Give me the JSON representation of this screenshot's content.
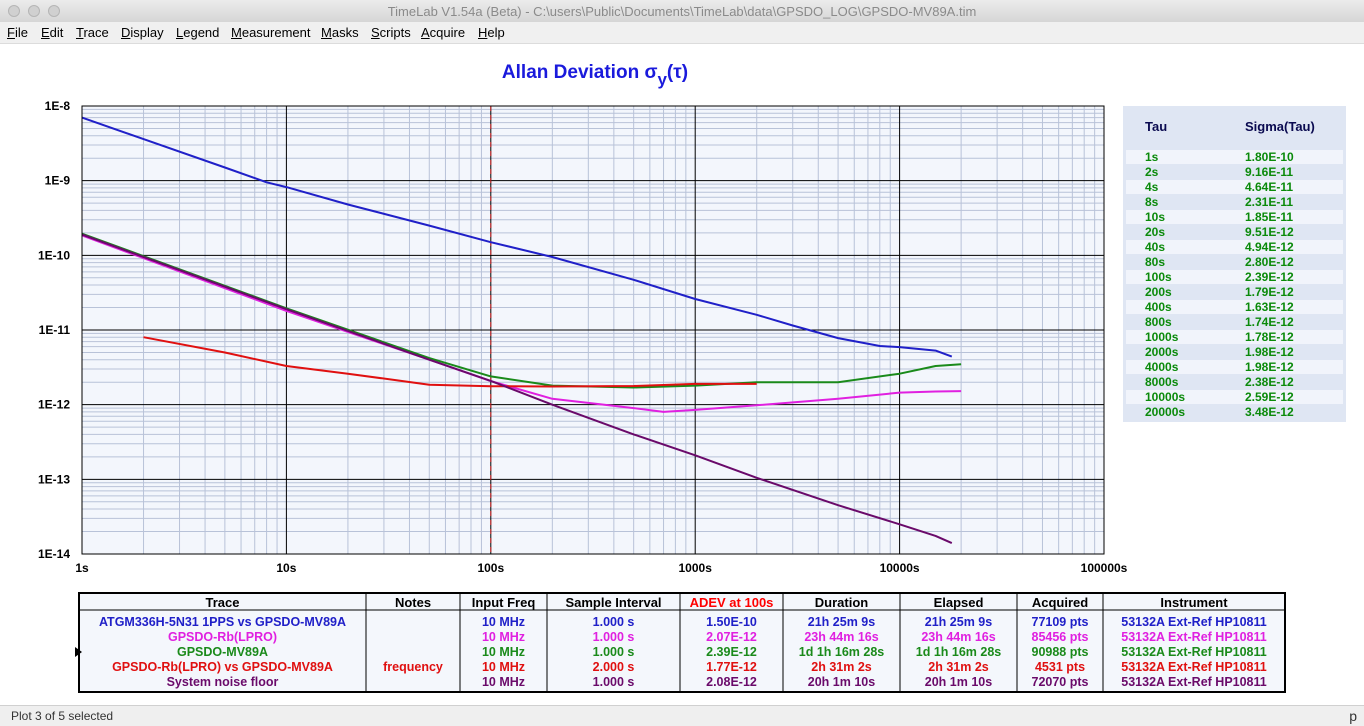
{
  "window": {
    "title": "TimeLab V1.54a (Beta) - C:\\users\\Public\\Documents\\TimeLab\\data\\GPSDO_LOG\\GPSDO-MV89A.tim"
  },
  "menu": [
    "File",
    "Edit",
    "Trace",
    "Display",
    "Legend",
    "Measurement",
    "Masks",
    "Scripts",
    "Acquire",
    "Help"
  ],
  "chart_data": {
    "type": "line",
    "title": "Allan Deviation σ",
    "title_sub": "y",
    "title_tail": "(τ)",
    "xscale": "log",
    "yscale": "log",
    "xlim": [
      1,
      100000
    ],
    "ylim": [
      1e-14,
      1e-08
    ],
    "grid": true,
    "reference_tau": 100,
    "x_ticks": [
      {
        "v": 1,
        "label": "1s"
      },
      {
        "v": 10,
        "label": "10s"
      },
      {
        "v": 100,
        "label": "100s"
      },
      {
        "v": 1000,
        "label": "1000s"
      },
      {
        "v": 10000,
        "label": "10000s"
      },
      {
        "v": 100000,
        "label": "100000s"
      }
    ],
    "y_ticks": [
      {
        "v": 1e-08,
        "label": "1E-8"
      },
      {
        "v": 1e-09,
        "label": "1E-9"
      },
      {
        "v": 1e-10,
        "label": "1E-10"
      },
      {
        "v": 1e-11,
        "label": "1E-11"
      },
      {
        "v": 1e-12,
        "label": "1E-12"
      },
      {
        "v": 1e-13,
        "label": "1E-13"
      },
      {
        "v": 1e-14,
        "label": "1E-14"
      }
    ],
    "series": [
      {
        "name": "ATGM336H-5N31 1PPS vs GPSDO-MV89A",
        "color": "#2020c8",
        "x": [
          1,
          2,
          5,
          8,
          10,
          20,
          50,
          100,
          200,
          500,
          1000,
          2000,
          3000,
          5000,
          8000,
          10000,
          15000,
          18000
        ],
        "y": [
          7e-09,
          3.6e-09,
          1.5e-09,
          9.5e-10,
          8.2e-10,
          4.8e-10,
          2.5e-10,
          1.5e-10,
          9.5e-11,
          4.7e-11,
          2.6e-11,
          1.6e-11,
          1.15e-11,
          7.8e-12,
          6.1e-12,
          5.9e-12,
          5.3e-12,
          4.4e-12
        ]
      },
      {
        "name": "GPSDO-Rb(LPRO)",
        "color": "#e020e0",
        "x": [
          1,
          10,
          50,
          100,
          200,
          500,
          700,
          1000,
          2000,
          5000,
          10000,
          15000,
          20000
        ],
        "y": [
          1.85e-10,
          1.8e-11,
          4e-12,
          2.07e-12,
          1.2e-12,
          9e-13,
          8e-13,
          8.5e-13,
          9.8e-13,
          1.2e-12,
          1.45e-12,
          1.5e-12,
          1.52e-12
        ]
      },
      {
        "name": "GPSDO-MV89A",
        "color": "#1a8a1a",
        "x": [
          1,
          10,
          50,
          100,
          200,
          500,
          1000,
          2000,
          5000,
          10000,
          15000,
          20000
        ],
        "y": [
          1.95e-10,
          1.95e-11,
          4.2e-12,
          2.39e-12,
          1.8e-12,
          1.7e-12,
          1.8e-12,
          2e-12,
          2e-12,
          2.6e-12,
          3.3e-12,
          3.48e-12
        ]
      },
      {
        "name": "GPSDO-Rb(LPRO) vs GPSDO-MV89A",
        "color": "#e01010",
        "x": [
          2,
          5,
          10,
          20,
          50,
          100,
          200,
          500,
          1000,
          2000
        ],
        "y": [
          8e-12,
          5e-12,
          3.3e-12,
          2.6e-12,
          1.85e-12,
          1.77e-12,
          1.75e-12,
          1.78e-12,
          1.9e-12,
          1.9e-12
        ]
      },
      {
        "name": "System noise floor",
        "color": "#6a0a6a",
        "x": [
          1,
          10,
          50,
          100,
          200,
          500,
          1000,
          2000,
          5000,
          10000,
          15000,
          18000
        ],
        "y": [
          1.9e-10,
          1.9e-11,
          4e-12,
          2.08e-12,
          1e-12,
          4e-13,
          2.1e-13,
          1.05e-13,
          4.5e-14,
          2.5e-14,
          1.75e-14,
          1.4e-14
        ]
      }
    ]
  },
  "sigma_table": {
    "headers": [
      "Tau",
      "Sigma(Tau)"
    ],
    "rows": [
      [
        "1s",
        "1.80E-10"
      ],
      [
        "2s",
        "9.16E-11"
      ],
      [
        "4s",
        "4.64E-11"
      ],
      [
        "8s",
        "2.31E-11"
      ],
      [
        "10s",
        "1.85E-11"
      ],
      [
        "20s",
        "9.51E-12"
      ],
      [
        "40s",
        "4.94E-12"
      ],
      [
        "80s",
        "2.80E-12"
      ],
      [
        "100s",
        "2.39E-12"
      ],
      [
        "200s",
        "1.79E-12"
      ],
      [
        "400s",
        "1.63E-12"
      ],
      [
        "800s",
        "1.74E-12"
      ],
      [
        "1000s",
        "1.78E-12"
      ],
      [
        "2000s",
        "1.98E-12"
      ],
      [
        "4000s",
        "1.98E-12"
      ],
      [
        "8000s",
        "2.38E-12"
      ],
      [
        "10000s",
        "2.59E-12"
      ],
      [
        "20000s",
        "3.48E-12"
      ]
    ],
    "text_color": "#0a8a0a"
  },
  "legend": {
    "headers": [
      "Trace",
      "Notes",
      "Input Freq",
      "Sample Interval",
      "ADEV at 100s",
      "Duration",
      "Elapsed",
      "Acquired",
      "Instrument"
    ],
    "adev_header_color": "#ff0000",
    "selected_index": 2,
    "rows": [
      {
        "color": "#2020c8",
        "cells": [
          "ATGM336H-5N31 1PPS vs GPSDO-MV89A",
          "",
          "10 MHz",
          "1.000 s",
          "1.50E-10",
          "21h 25m 9s",
          "21h 25m 9s",
          "77109 pts",
          "53132A Ext-Ref HP10811"
        ]
      },
      {
        "color": "#e020e0",
        "cells": [
          "GPSDO-Rb(LPRO)",
          "",
          "10 MHz",
          "1.000 s",
          "2.07E-12",
          "23h 44m 16s",
          "23h 44m 16s",
          "85456 pts",
          "53132A Ext-Ref HP10811"
        ]
      },
      {
        "color": "#1a8a1a",
        "cells": [
          "GPSDO-MV89A",
          "",
          "10 MHz",
          "1.000 s",
          "2.39E-12",
          "1d 1h 16m 28s",
          "1d 1h 16m 28s",
          "90988 pts",
          "53132A Ext-Ref HP10811"
        ]
      },
      {
        "color": "#e01010",
        "cells": [
          "GPSDO-Rb(LPRO) vs GPSDO-MV89A",
          "frequency",
          "10 MHz",
          "2.000 s",
          "1.77E-12",
          "2h 31m 2s",
          "2h 31m 2s",
          "4531 pts",
          "53132A Ext-Ref HP10811"
        ]
      },
      {
        "color": "#6a0a6a",
        "cells": [
          "System noise floor",
          "",
          "10 MHz",
          "1.000 s",
          "2.08E-12",
          "20h 1m 10s",
          "20h 1m 10s",
          "72070 pts",
          "53132A Ext-Ref HP10811"
        ]
      }
    ]
  },
  "status": {
    "text": "Plot 3 of 5 selected",
    "right": "p"
  }
}
